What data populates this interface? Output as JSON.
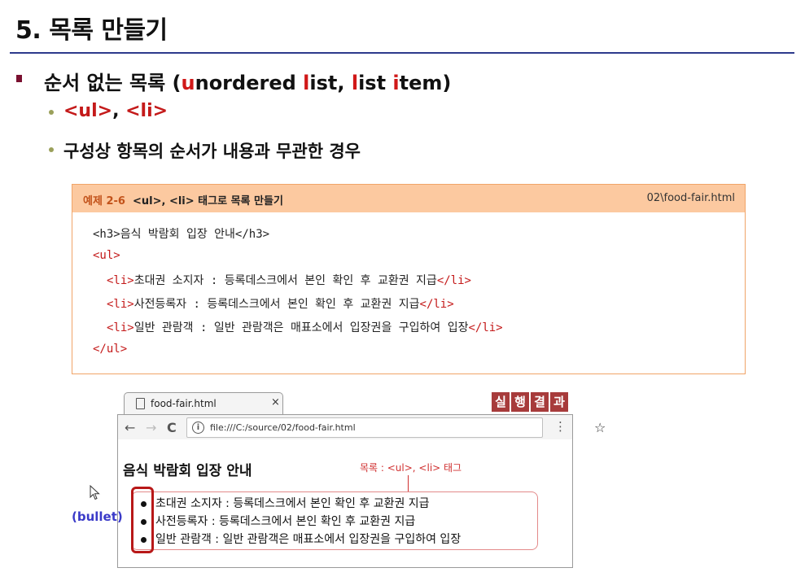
{
  "slide": {
    "title": "5. 목록 만들기",
    "heading_prefix": "순서 없는 목록 (",
    "heading_u": "u",
    "heading_mid1": "nordered ",
    "heading_l1": "l",
    "heading_mid2": "ist, ",
    "heading_l2": "l",
    "heading_mid3": "ist ",
    "heading_i": "i",
    "heading_suffix": "tem)",
    "tags_ul": "<ul>",
    "tags_sep": ", ",
    "tags_li": "<li>",
    "desc": "구성상 항목의 순서가 내용과 무관한 경우"
  },
  "example": {
    "number": "예제 2-6",
    "title": "<ul>, <li> 태그로 목록 만들기",
    "file": "02\\food-fair.html",
    "code": {
      "h3_line": "<h3>음식 박람회 입장 안내</h3>",
      "ul_open": "<ul>",
      "li_open": "<li>",
      "li_close": "</li>",
      "item1": "초대권 소지자 : 등록데스크에서 본인 확인 후 교환권 지급",
      "item2": "사전등록자 : 등록데스크에서 본인 확인 후 교환권 지급",
      "item3": "일반 관람객 : 일반 관람객은 매표소에서 입장권을 구입하여 입장",
      "ul_close": "</ul>"
    }
  },
  "run_badge": [
    "실",
    "행",
    "결",
    "과"
  ],
  "browser": {
    "tab_title": "food-fair.html",
    "tab_close": "×",
    "nav_back": "←",
    "nav_forward": "→",
    "nav_reload": "C",
    "info": "i",
    "url": "file:///C:/source/02/food-fair.html",
    "star": "☆",
    "menu": "⋮",
    "page_heading": "음식 박람회 입장 안내",
    "list_items": [
      "초대권 소지자 : 등록데스크에서 본인 확인 후 교환권 지급",
      "사전등록자 : 등록데스크에서 본인 확인 후 교환권 지급",
      "일반 관람객 : 일반 관람객은 매표소에서 입장권을 구입하여 입장"
    ]
  },
  "annotations": {
    "callout": "목록 : <ul>, <li> 태그",
    "bullet": "(bullet)"
  }
}
